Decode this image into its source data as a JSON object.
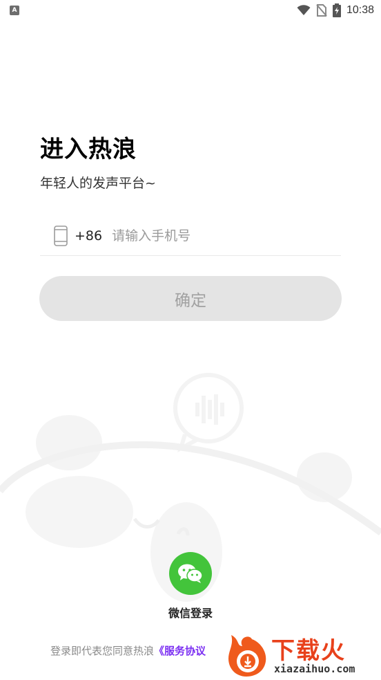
{
  "status_bar": {
    "notification_badge": "A",
    "time": "10:38",
    "icons": [
      "wifi-icon",
      "no-sim-icon",
      "battery-charging-icon"
    ]
  },
  "header": {
    "title": "进入热浪",
    "subtitle": "年轻人的发声平台~"
  },
  "login_form": {
    "country_code": "+86",
    "phone_placeholder": "请输入手机号",
    "phone_value": "",
    "confirm_label": "确定"
  },
  "social_login": {
    "wechat_label": "微信登录"
  },
  "agreement": {
    "prefix": "登录即代表您同意热浪",
    "service_link": "《服务协议"
  },
  "watermark": {
    "brand": "下载火",
    "url": "xiazaihuo.com"
  },
  "colors": {
    "wechat_green": "#43c43b",
    "link_purple": "#7b2ff2",
    "button_disabled_bg": "#e4e4e4",
    "watermark_orange": "#e8411b"
  }
}
